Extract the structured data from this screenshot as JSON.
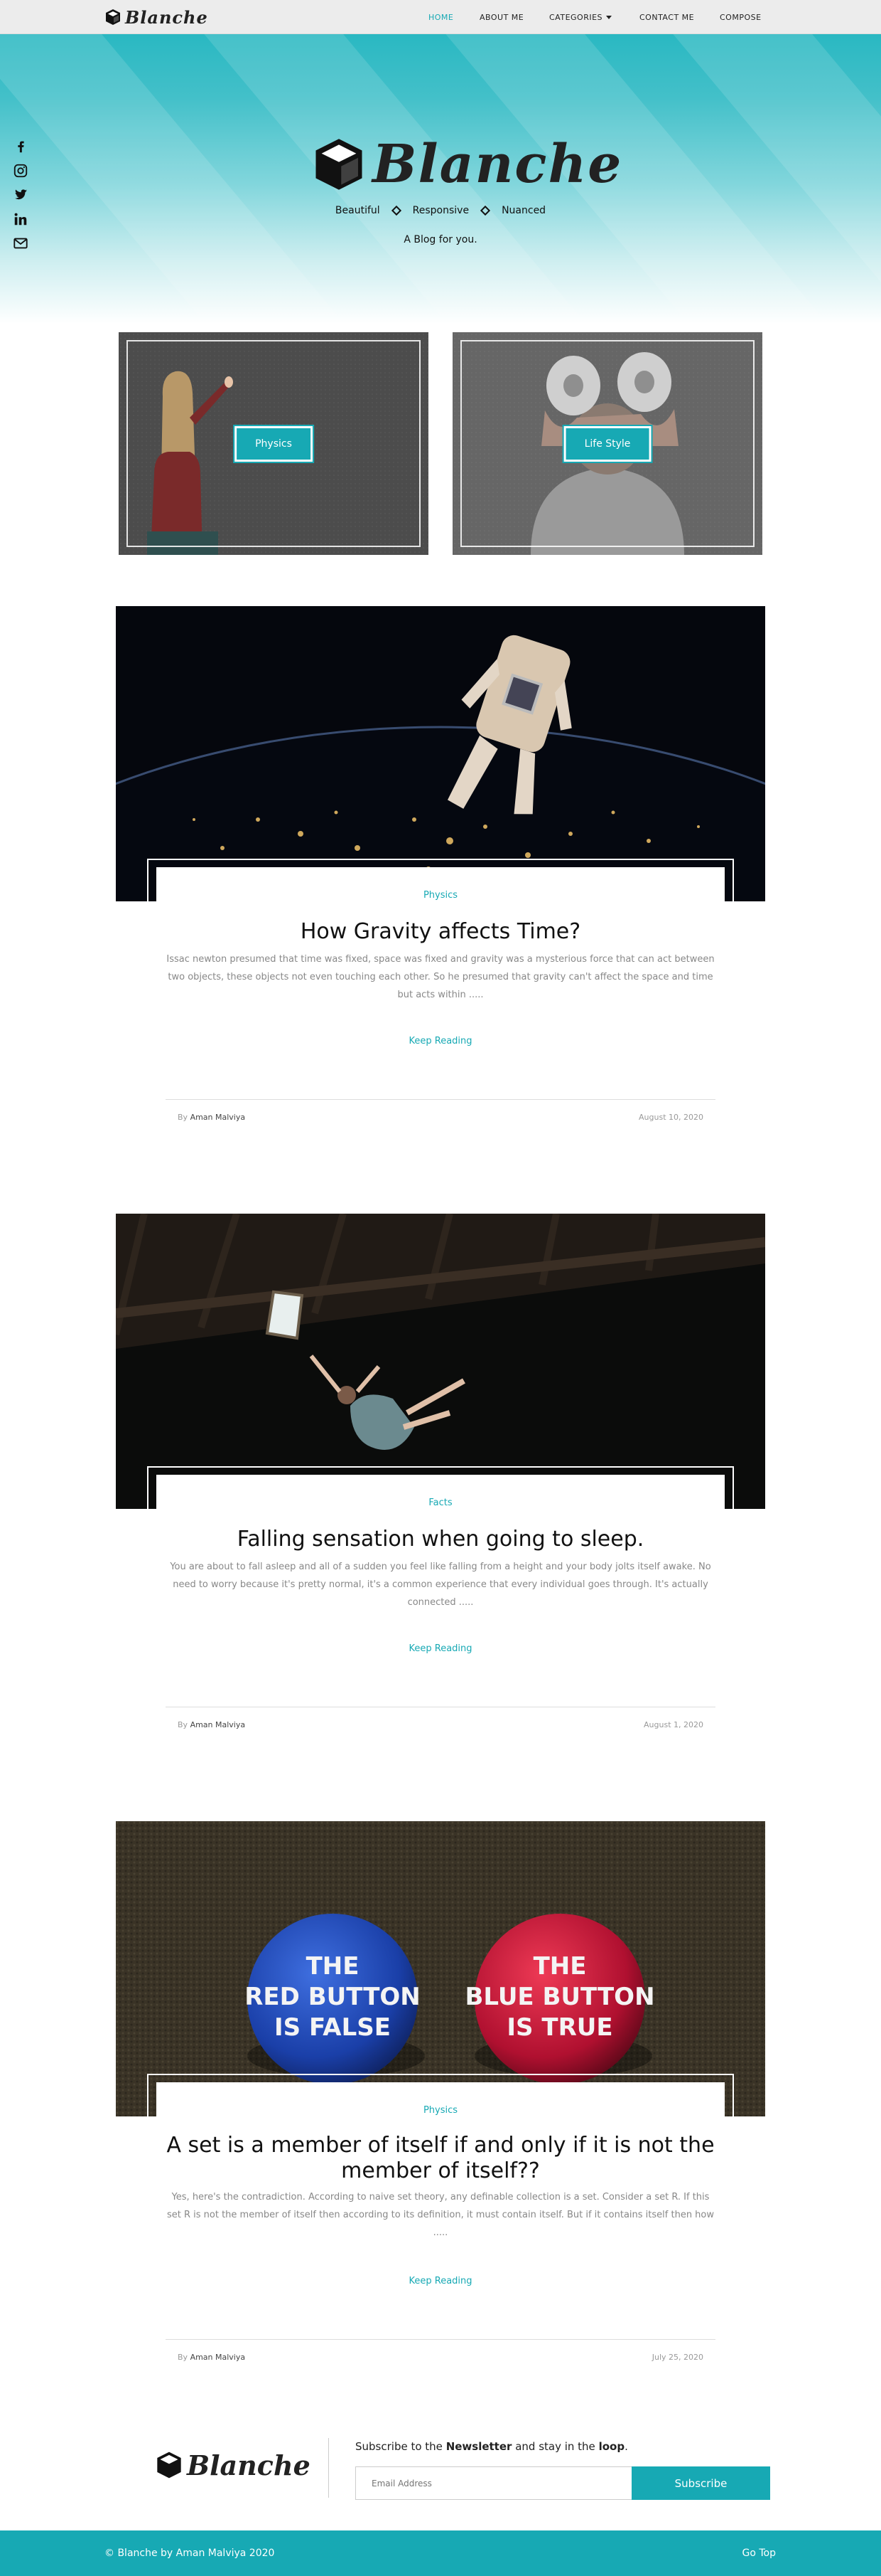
{
  "brand": {
    "name": "Blanche",
    "logo_icon": "cube-icon"
  },
  "nav": {
    "home": "HOME",
    "about": "ABOUT ME",
    "categories": "CATEGORIES",
    "contact": "CONTACT ME",
    "compose": "COMPOSE",
    "active": "HOME"
  },
  "hero": {
    "title": "Blanche",
    "tags": [
      "Beautiful",
      "Responsive",
      "Nuanced"
    ],
    "tagline": "A Blog for you."
  },
  "social": [
    "facebook-icon",
    "instagram-icon",
    "twitter-icon",
    "linkedin-icon",
    "mail-icon"
  ],
  "categories": [
    {
      "label": "Physics"
    },
    {
      "label": "Life Style"
    }
  ],
  "posts": [
    {
      "category": "Physics",
      "title": "How Gravity affects Time?",
      "excerpt": "Issac newton presumed that time was fixed, space was fixed and gravity was a mysterious force that can act between two objects, these objects not even touching each other. So he presumed that gravity can't affect the space and time but acts within .....",
      "read_more": "Keep Reading",
      "author_prefix": "By",
      "author": "Aman Malviya",
      "date": "August 10, 2020"
    },
    {
      "category": "Facts",
      "title": "Falling sensation when going to sleep.",
      "excerpt": "You are about to fall asleep and all of a sudden you feel like falling from a height and your body jolts itself awake. No need to worry because it's pretty normal, it's a common experience that every individual goes through. It's actually connected .....",
      "read_more": "Keep Reading",
      "author_prefix": "By",
      "author": "Aman Malviya",
      "date": "August 1, 2020"
    },
    {
      "category": "Physics",
      "title": "A set is a member of itself if and only if it is not the member of itself??",
      "excerpt": "Yes, here's the contradiction. According to naive set theory, any definable collection is a set. Consider a set R. If this set R is not the member of itself then according to its definition, it must contain itself. But if it contains itself then how .....",
      "read_more": "Keep Reading",
      "author_prefix": "By",
      "author": "Aman Malviya",
      "date": "July 25, 2020"
    }
  ],
  "post3_buttons": {
    "left": [
      "THE",
      "RED BUTTON",
      "IS FALSE"
    ],
    "right": [
      "THE",
      "BLUE BUTTON",
      "IS TRUE"
    ]
  },
  "footer": {
    "logo": "Blanche",
    "newsletter_pre": "Subscribe to the ",
    "newsletter_bold": "Newsletter",
    "newsletter_mid": " and stay in the ",
    "newsletter_bold2": "loop",
    "newsletter_end": ".",
    "email_placeholder": "Email Address",
    "subscribe": "Subscribe",
    "copyright": "© Blanche by Aman Malviya 2020",
    "go_top": "Go Top"
  },
  "colors": {
    "accent": "#17a9b4"
  }
}
